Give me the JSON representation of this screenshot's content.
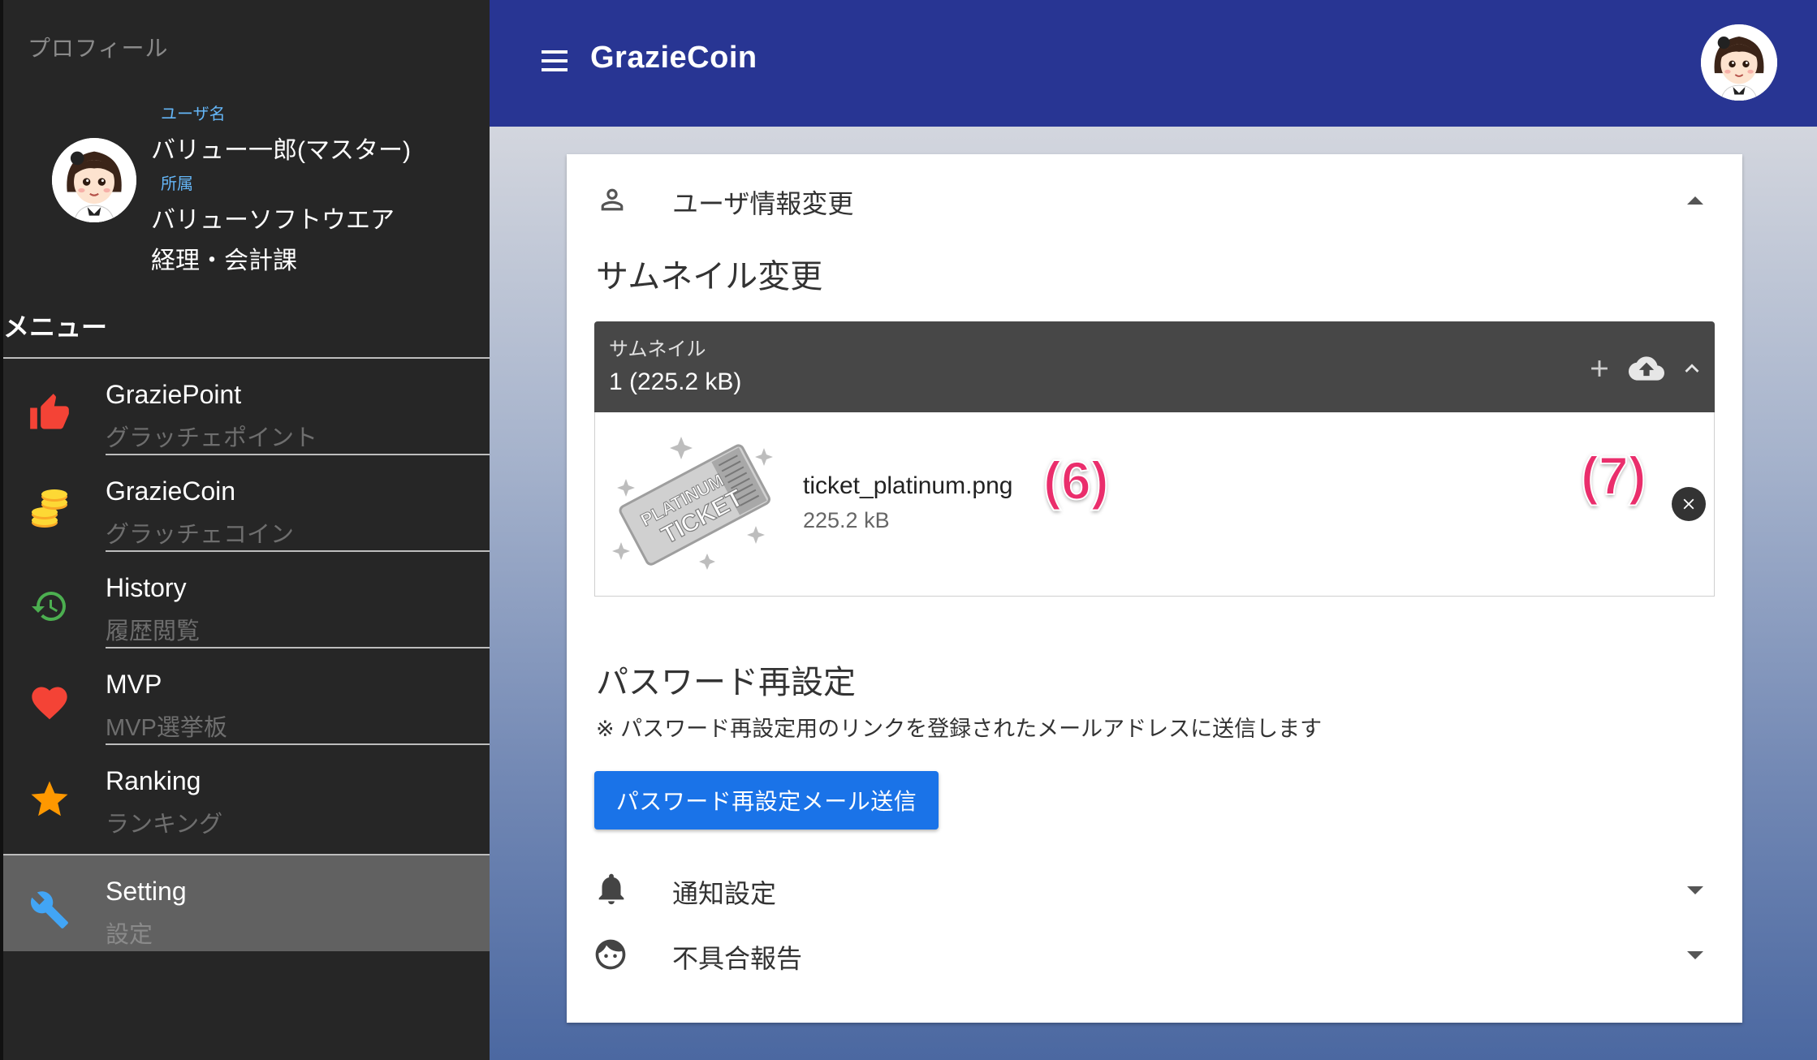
{
  "sidebar": {
    "profile_heading": "プロフィール",
    "username_caption": "ユーザ名",
    "username": "バリュー一郎(マスター)",
    "affiliation_caption": "所属",
    "company": "バリューソフトウエア",
    "department": "経理・会計課",
    "menu_heading": "メニュー",
    "items": [
      {
        "title": "GraziePoint",
        "subtitle": "グラッチェポイント",
        "icon": "thumbs-up-icon",
        "color": "#f44336"
      },
      {
        "title": "GrazieCoin",
        "subtitle": "グラッチェコイン",
        "icon": "coins-icon",
        "color": "#fdd835"
      },
      {
        "title": "History",
        "subtitle": "履歴閲覧",
        "icon": "history-icon",
        "color": "#4caf50"
      },
      {
        "title": "MVP",
        "subtitle": "MVP選挙板",
        "icon": "heart-icon",
        "color": "#f44336"
      },
      {
        "title": "Ranking",
        "subtitle": "ランキング",
        "icon": "star-icon",
        "color": "#ff9800"
      },
      {
        "title": "Setting",
        "subtitle": "設定",
        "icon": "wrench-icon",
        "color": "#42a5f5",
        "active": true
      }
    ]
  },
  "header": {
    "title": "GrazieCoin"
  },
  "main": {
    "user_panel_title": "ユーザ情報変更",
    "thumbnail_section_title": "サムネイル変更",
    "file_input": {
      "label": "サムネイル",
      "value": "1 (225.2 kB)"
    },
    "file": {
      "name": "ticket_platinum.png",
      "size": "225.2 kB",
      "thumbnail_text_line1": "PLATINUM",
      "thumbnail_text_line2": "TICKET"
    },
    "annotations": {
      "a6": "(6)",
      "a7": "(7)"
    },
    "password_section_title": "パスワード再設定",
    "password_note": "※ パスワード再設定用のリンクを登録されたメールアドレスに送信します",
    "password_button": "パスワード再設定メール送信",
    "notification_panel_title": "通知設定",
    "bug_report_panel_title": "不具合報告"
  }
}
